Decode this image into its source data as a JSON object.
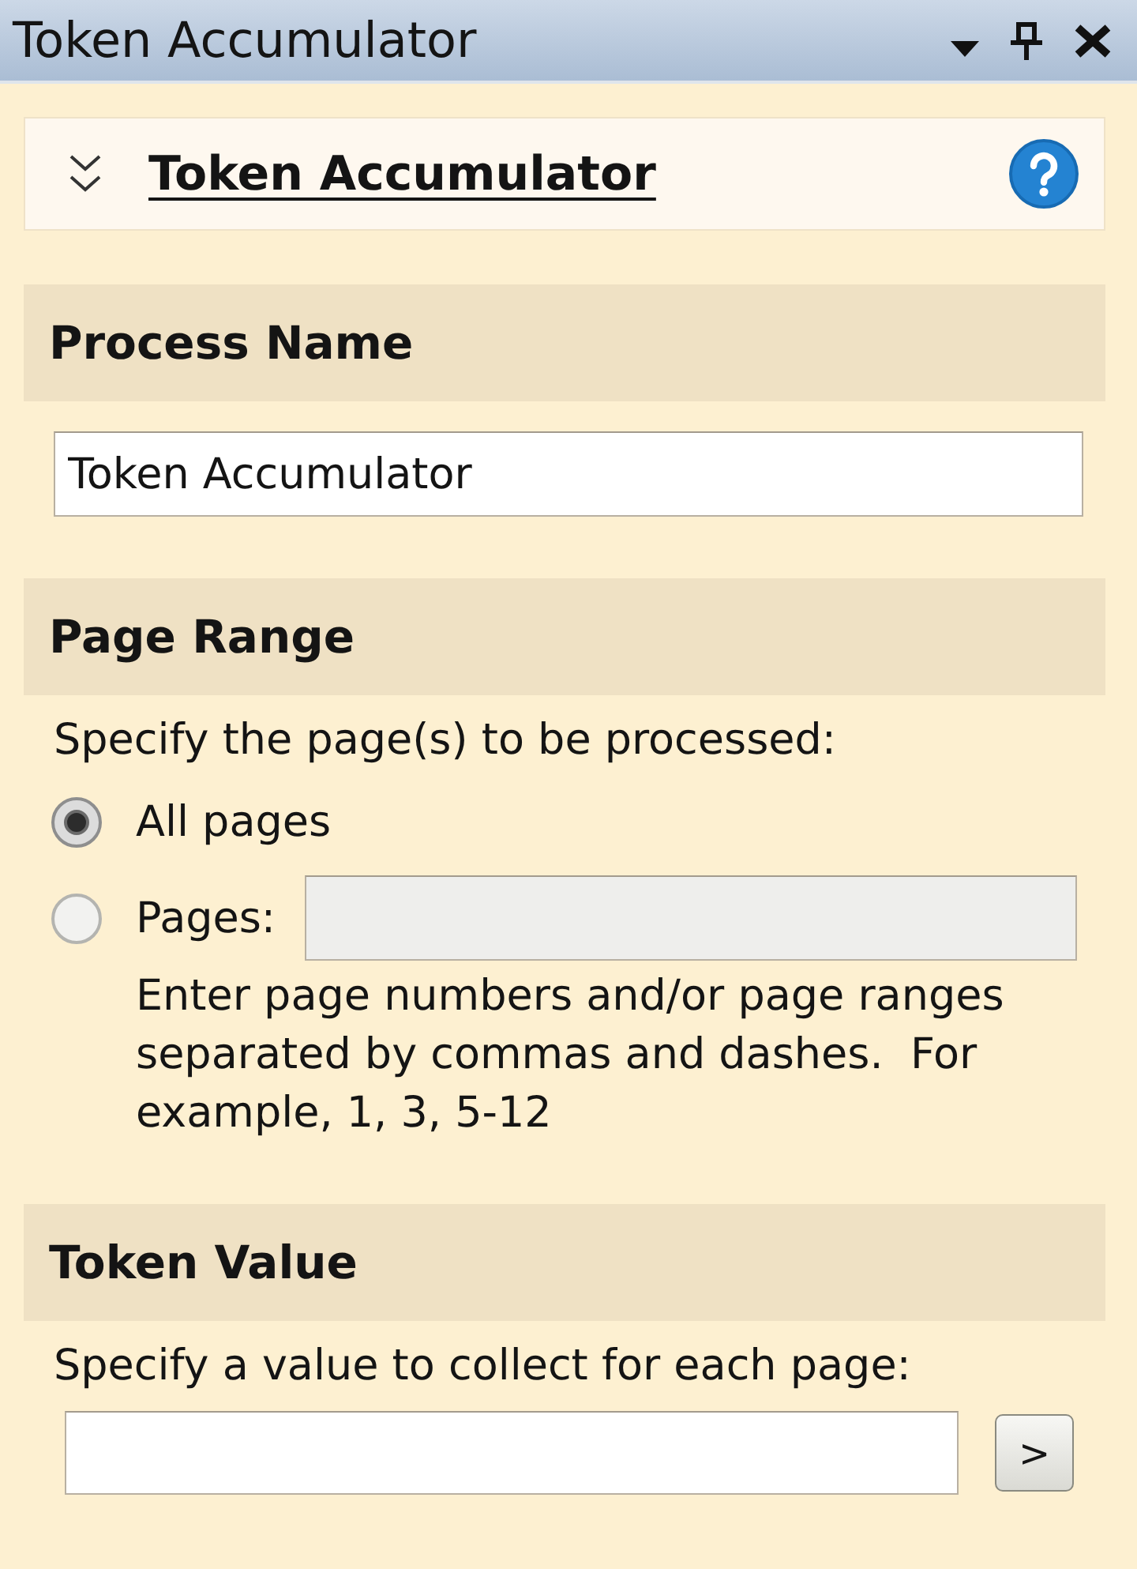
{
  "window": {
    "title": "Token Accumulator"
  },
  "panel": {
    "title": "Token Accumulator"
  },
  "sections": [
    {
      "kind": "text_field",
      "title": "Process Name",
      "value": "Token Accumulator"
    },
    {
      "kind": "page_range",
      "title": "Page Range",
      "prompt": "Specify the page(s) to be processed:",
      "options": [
        {
          "label": "All pages",
          "selected": true
        },
        {
          "label": "Pages:",
          "selected": false,
          "field": {
            "disabled": true
          },
          "hint": "Enter page numbers and/or page ranges separated by commas and dashes.  For example, 1, 3, 5-12"
        }
      ]
    },
    {
      "kind": "value_entry",
      "title": "Token Value",
      "prompt": "Specify a value to collect for each page:",
      "button": {
        "label": ">"
      }
    }
  ]
}
